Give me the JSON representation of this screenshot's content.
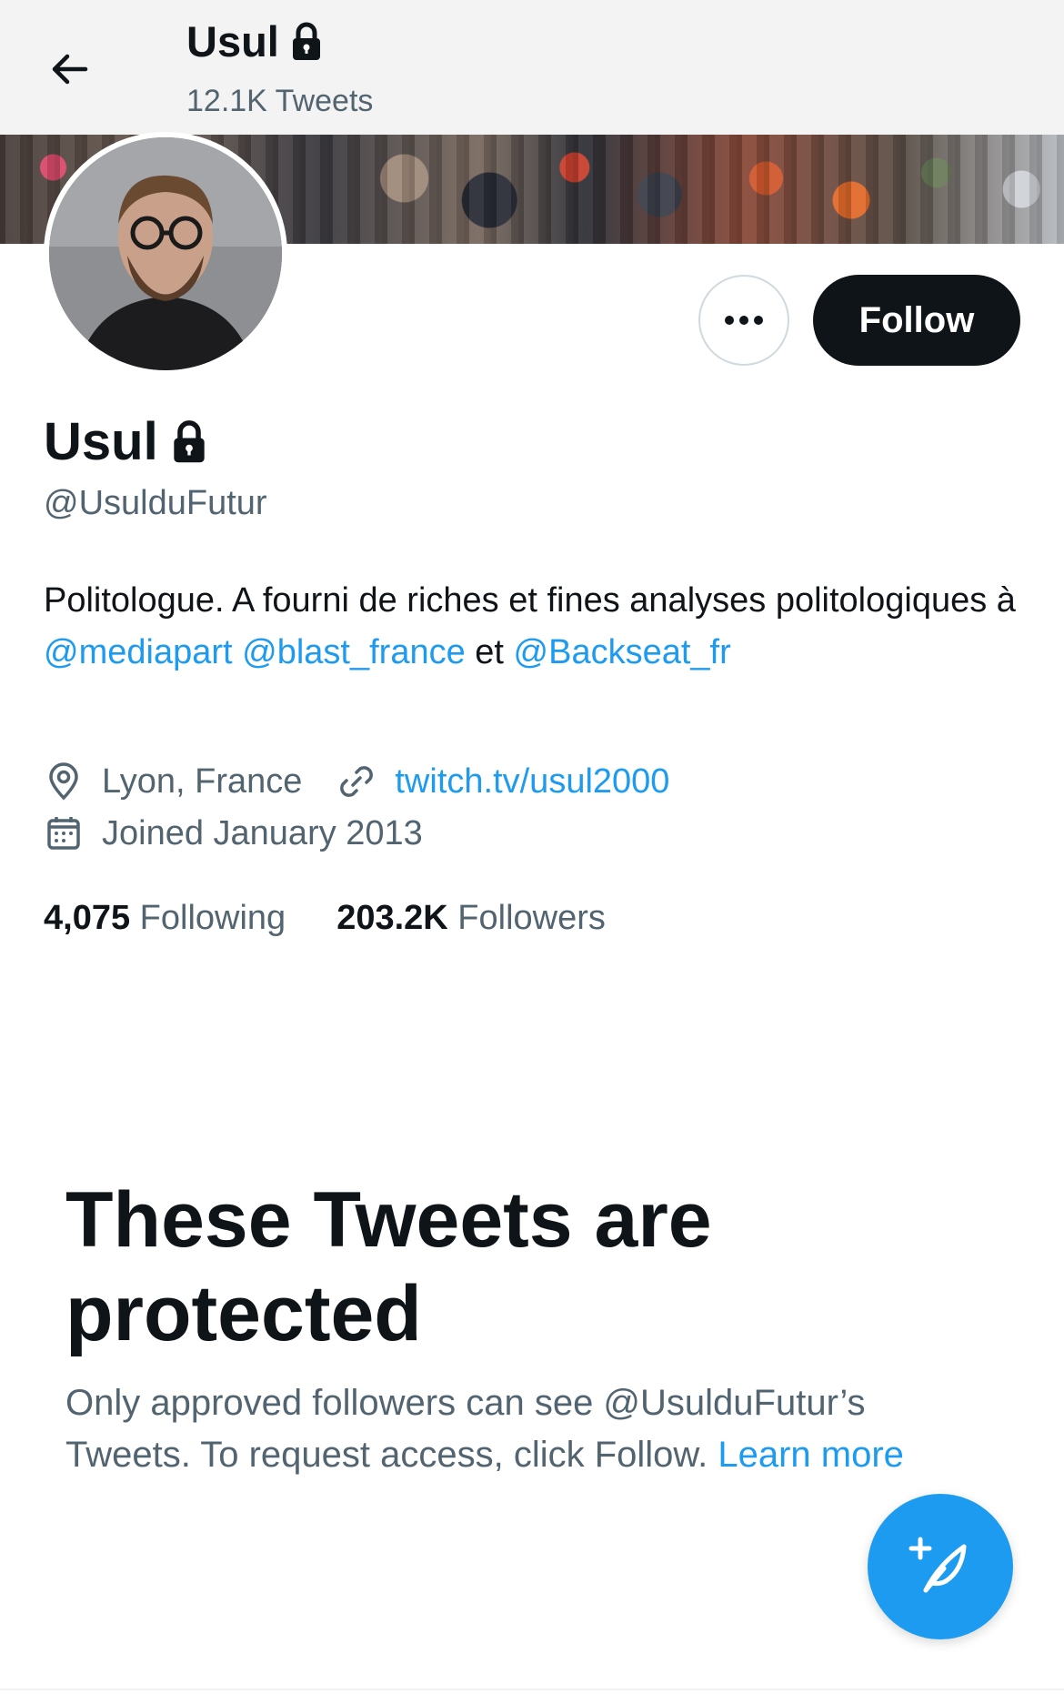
{
  "header": {
    "title": "Usul",
    "tweet_count": "12.1K Tweets"
  },
  "profile": {
    "display_name": "Usul",
    "handle": "@UsulduFutur",
    "bio_text_1": "Politologue. A fourni de riches et fines analyses politologiques à ",
    "bio_mention_1": "@mediapart",
    "bio_space": " ",
    "bio_mention_2": "@blast_france",
    "bio_text_2": " et ",
    "bio_mention_3": "@Backseat_fr",
    "location": "Lyon, France",
    "website": "twitch.tv/usul2000",
    "joined": "Joined January 2013",
    "following_count": "4,075",
    "following_label": "Following",
    "followers_count": "203.2K",
    "followers_label": "Followers"
  },
  "actions": {
    "follow_label": "Follow"
  },
  "protected": {
    "title": "These Tweets are protected",
    "text": "Only approved followers can see @UsulduFutur’s Tweets. To request access, click Follow. ",
    "learn_more": "Learn more"
  },
  "colors": {
    "accent": "#1d9bf0",
    "text": "#0f1419",
    "secondary": "#536471"
  },
  "icons": {
    "back": "arrow-left-icon",
    "lock": "lock-icon",
    "more": "more-dots-icon",
    "location": "location-pin-icon",
    "link": "link-icon",
    "calendar": "calendar-icon",
    "compose": "compose-tweet-icon"
  }
}
